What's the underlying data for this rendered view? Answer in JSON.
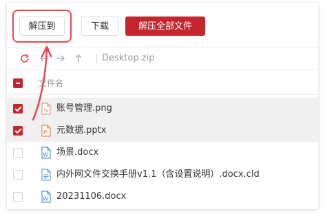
{
  "toolbar": {
    "extract_to_label": "解压到",
    "download_label": "下载",
    "extract_all_label": "解压全部文件"
  },
  "nav": {
    "path": "Desktop.zip"
  },
  "list": {
    "header_label": "文件名",
    "files": [
      {
        "name": "账号管理.png",
        "icon": "image-file-icon",
        "checked": true
      },
      {
        "name": "元数据.pptx",
        "icon": "pptx-file-icon",
        "checked": true
      },
      {
        "name": "场景.docx",
        "icon": "docx-file-icon",
        "checked": false
      },
      {
        "name": "内外网文件交换手册v1.1（含设置说明）.docx.cld",
        "icon": "text-file-icon",
        "checked": false
      },
      {
        "name": "20231106.docx",
        "icon": "docx-file-icon",
        "checked": false
      }
    ]
  },
  "colors": {
    "accent": "#c4262e",
    "annotation": "#e8474f"
  }
}
